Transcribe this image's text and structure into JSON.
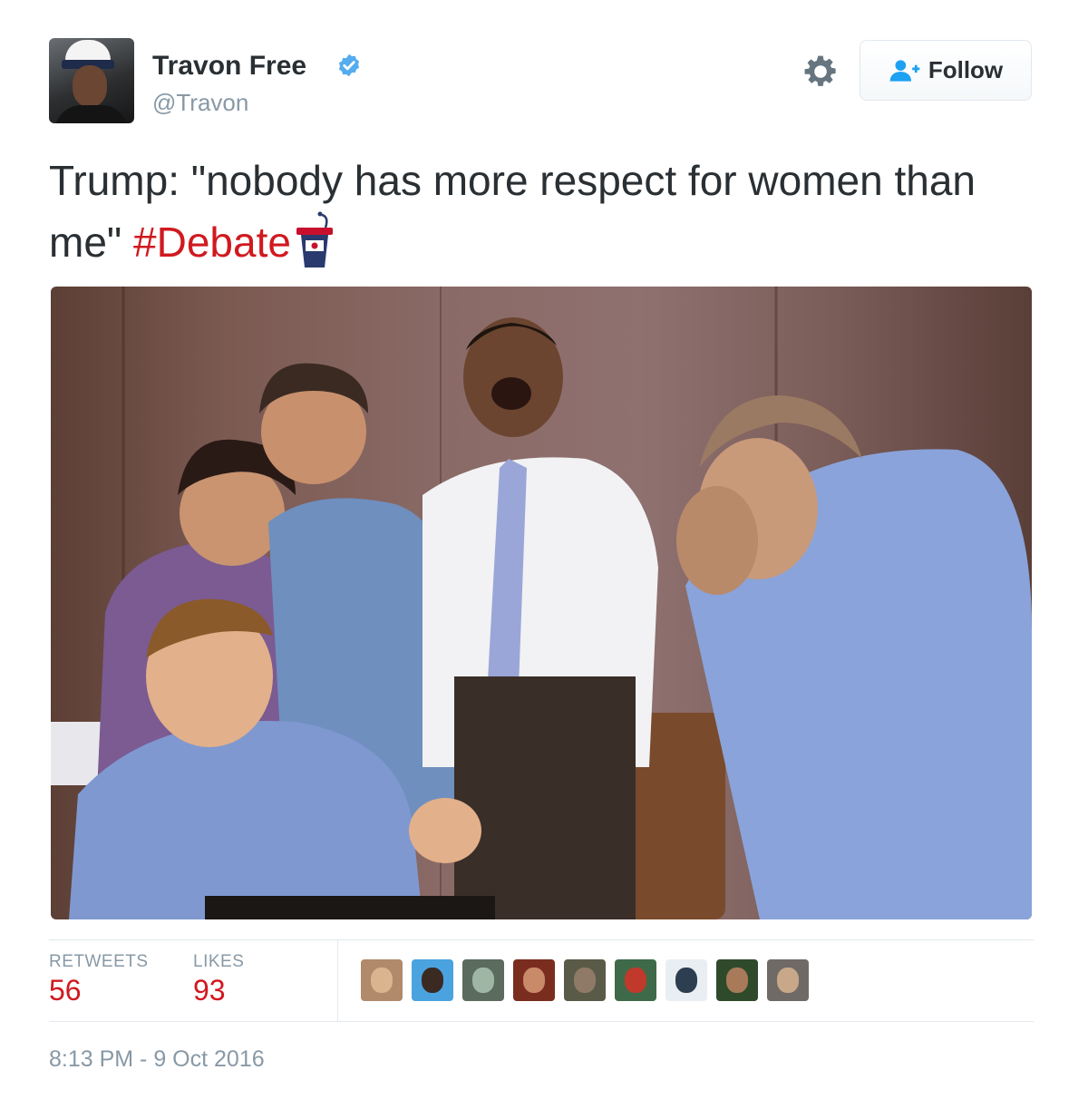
{
  "author": {
    "name": "Travon Free",
    "handle": "@Travon",
    "verified": true
  },
  "actions": {
    "settings_icon": "gear-icon",
    "follow_label": "Follow",
    "follow_icon": "add-user-icon"
  },
  "tweet": {
    "text": "Trump: \"nobody has more respect for women than me\" ",
    "hashtag": "#Debate",
    "hashtag_color": "#d0191f",
    "emoji_icon": "podium-icon"
  },
  "stats": {
    "retweets_label": "RETWEETS",
    "retweets_count": "56",
    "likes_label": "LIKES",
    "likes_count": "93"
  },
  "likers": [
    {
      "bg": "#b08a6a",
      "face": "#d9b48f"
    },
    {
      "bg": "#4aa3df",
      "face": "#3a2a22"
    },
    {
      "bg": "#5b6b5e",
      "face": "#9fb6a5"
    },
    {
      "bg": "#7a2d1e",
      "face": "#c98a6a"
    },
    {
      "bg": "#5a5a48",
      "face": "#8e7a66"
    },
    {
      "bg": "#3f6a4a",
      "face": "#c0392b"
    },
    {
      "bg": "#e9eef2",
      "face": "#2d3e50"
    },
    {
      "bg": "#2f4a2a",
      "face": "#a87a5a"
    },
    {
      "bg": "#6f6a66",
      "face": "#c9a88a"
    }
  ],
  "timestamp": "8:13 PM - 9 Oct 2016",
  "colors": {
    "accent": "#d0191f",
    "muted": "#8899a6",
    "verified": "#1da1f2"
  }
}
